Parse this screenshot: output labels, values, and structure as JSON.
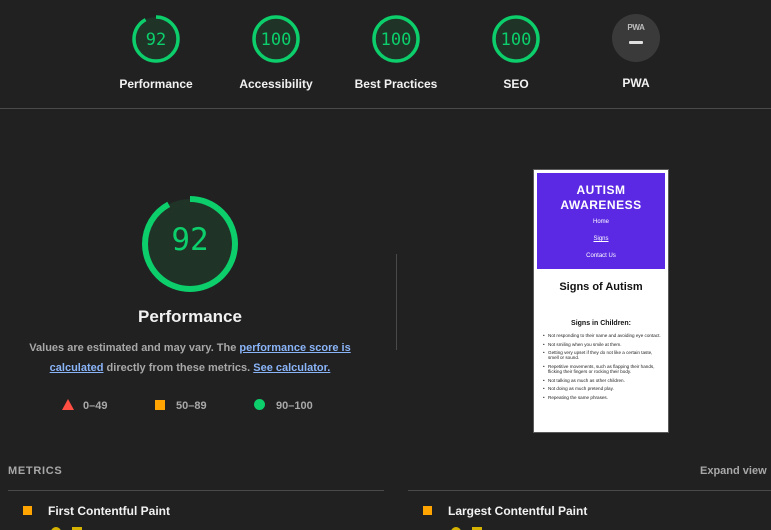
{
  "categories": [
    {
      "label": "Performance",
      "score": "92",
      "value": 92
    },
    {
      "label": "Accessibility",
      "score": "100",
      "value": 100
    },
    {
      "label": "Best Practices",
      "score": "100",
      "value": 100
    },
    {
      "label": "SEO",
      "score": "100",
      "value": 100
    }
  ],
  "pwa": {
    "badge": "PWA",
    "label": "PWA"
  },
  "main": {
    "score": "92",
    "title": "Performance",
    "note_prefix": "Values are estimated and may vary. The ",
    "note_link1": "performance score is calculated",
    "note_middle": " directly from these metrics. ",
    "note_link2": "See calculator."
  },
  "legend": {
    "fail": "0–49",
    "average": "50–89",
    "pass": "90–100"
  },
  "screenshot": {
    "header_title": "AUTISM AWARENESS",
    "nav": [
      "Home",
      "Signs",
      "Contact Us"
    ],
    "page_title": "Signs of Autism",
    "subheading": "Signs in Children:",
    "items": [
      "Not responding to their name and avoiding eye contact.",
      "Not smiling when you smile at them.",
      "Getting very upset if they do not like a certain taste, smell or sound.",
      "Repetitive movements, such as flapping their hands, flicking their fingers or rocking their body.",
      "Not talking as much as other children.",
      "Not doing as much pretend play.",
      "Repeating the same phrases."
    ]
  },
  "metrics": {
    "section_label": "METRICS",
    "expand": "Expand view",
    "items": [
      {
        "name": "First Contentful Paint"
      },
      {
        "name": "Largest Contentful Paint"
      }
    ]
  },
  "colors": {
    "pass": "#0cce6b",
    "average": "#ffa400",
    "fail": "#ff4e42",
    "accent_link": "#8ab4f8",
    "site_header": "#5b29e3"
  }
}
